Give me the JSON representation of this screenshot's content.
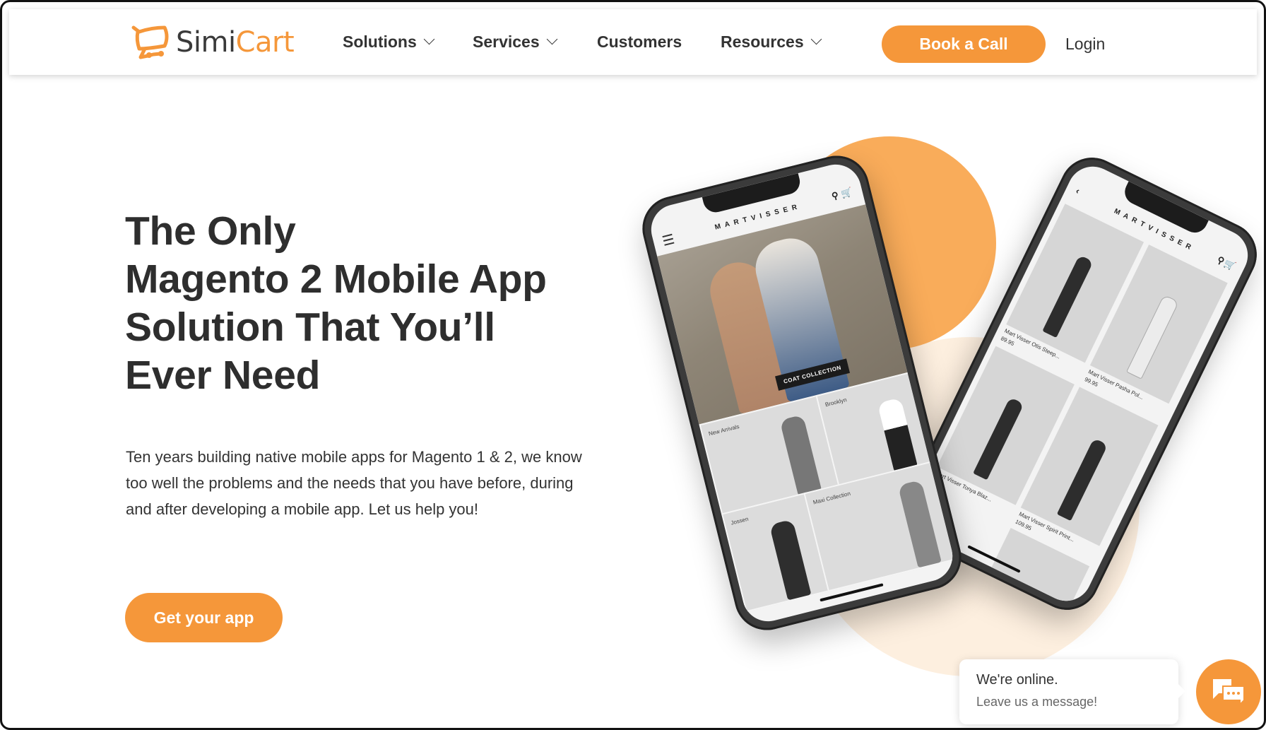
{
  "brand": {
    "name_part1": "Simi",
    "name_part2": "Cart",
    "accent_color": "#f5973a"
  },
  "nav": {
    "items": [
      {
        "label": "Solutions",
        "has_dropdown": true
      },
      {
        "label": "Services",
        "has_dropdown": true
      },
      {
        "label": "Customers",
        "has_dropdown": false
      },
      {
        "label": "Resources",
        "has_dropdown": true
      }
    ],
    "cta_label": "Book a Call",
    "login_label": "Login"
  },
  "hero": {
    "headline_lines": [
      "The Only",
      "Magento 2 Mobile App",
      "Solution That You’ll",
      "Ever Need"
    ],
    "paragraph": "Ten years building native mobile apps for Magento 1 & 2, we know too well the problems and the needs that you have before, during and after developing a mobile app. Let us help you!",
    "cta_label": "Get your app"
  },
  "phone_left": {
    "store_name": "MARTVISSER",
    "banner_tag": "COAT COLLECTION",
    "tiles": [
      "New Arrivals",
      "Brooklyn",
      "Jossen",
      "Maxi Collection"
    ]
  },
  "phone_right": {
    "store_name": "MARTVISSER",
    "products": [
      {
        "name": "Mart Visser Otis Steep...",
        "price": "89.95"
      },
      {
        "name": "Mart Visser Pasha Pol...",
        "price": "99.95"
      },
      {
        "name": "Mart Visser Tonya Blaz...",
        "price": ""
      },
      {
        "name": "Mart Visser Spirit Print...",
        "price": "109.95"
      }
    ]
  },
  "chat": {
    "title": "We're online.",
    "subtitle": "Leave us a message!"
  }
}
